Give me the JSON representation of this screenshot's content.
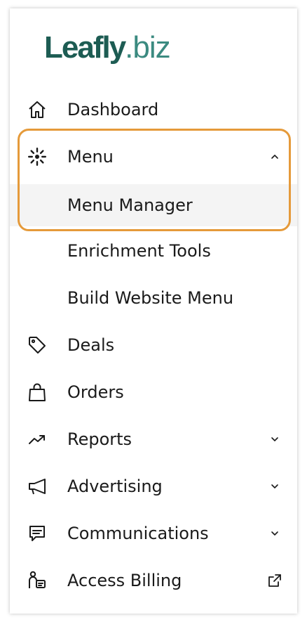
{
  "logo": {
    "brand": "Leafly",
    "dot": ".",
    "tld": "biz"
  },
  "nav": {
    "dashboard": "Dashboard",
    "menu": "Menu",
    "menu_manager": "Menu Manager",
    "enrichment_tools": "Enrichment Tools",
    "build_website_menu": "Build Website Menu",
    "deals": "Deals",
    "orders": "Orders",
    "reports": "Reports",
    "advertising": "Advertising",
    "communications": "Communications",
    "access_billing": "Access Billing"
  },
  "icons": {
    "dashboard": "home-icon",
    "menu": "leaf-burst-icon",
    "deals": "tag-icon",
    "orders": "shopping-bag-icon",
    "reports": "trend-up-icon",
    "advertising": "megaphone-icon",
    "communications": "chat-icon",
    "access_billing": "person-card-icon",
    "menu_expanded": "chevron-up-icon",
    "collapsed": "chevron-down-icon",
    "external": "external-link-icon"
  },
  "colors": {
    "brand_dark": "#1d5c53",
    "brand_light": "#3b8a80",
    "highlight": "#e59a3a",
    "subitem_bg": "#f4f4f4",
    "text": "#1a1a1a"
  }
}
